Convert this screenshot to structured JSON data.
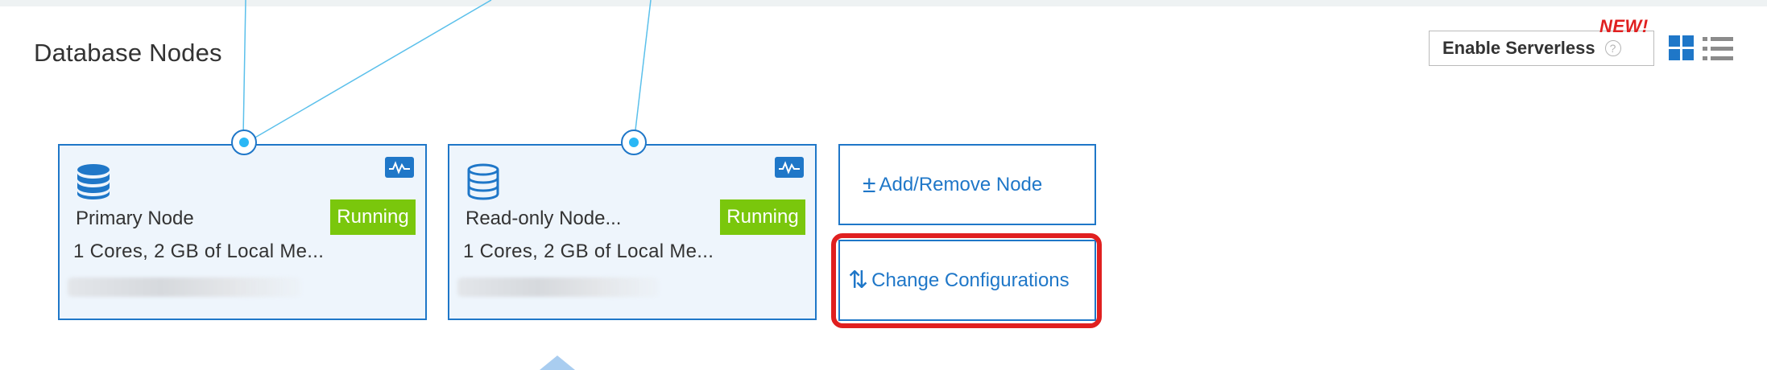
{
  "header": {
    "title": "Database Nodes"
  },
  "toolbar": {
    "enable_serverless_label": "Enable Serverless",
    "help_glyph": "?",
    "new_badge": "NEW!",
    "view_modes": [
      "grid-view",
      "list-view"
    ],
    "active_view": "grid-view"
  },
  "nodes": [
    {
      "name": "Primary Node",
      "status": "Running",
      "spec": "1 Cores, 2 GB of Local Me...",
      "icon": "database-filled-icon"
    },
    {
      "name": "Read-only Node...",
      "status": "Running",
      "spec": "1 Cores, 2 GB of Local Me...",
      "icon": "database-outline-icon"
    }
  ],
  "actions": {
    "add_remove_label": "Add/Remove Node",
    "add_remove_glyph": "±",
    "change_config_label": "Change Configurations",
    "change_config_glyph": "⇅"
  },
  "colors": {
    "accent": "#1f77c8",
    "running": "#7ac70c",
    "connector_dot": "#2ab7f5",
    "highlight": "#e02020",
    "new_badge": "#e02020"
  }
}
